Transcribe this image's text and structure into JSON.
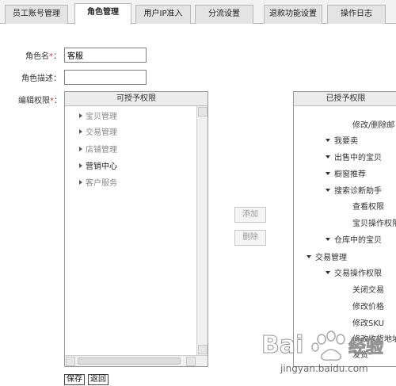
{
  "tabs": [
    {
      "label": "员工账号管理"
    },
    {
      "label": "角色管理"
    },
    {
      "label": "用户IP准入"
    },
    {
      "label": "分流设置"
    },
    {
      "label": "退款功能设置"
    },
    {
      "label": "操作日志"
    }
  ],
  "form": {
    "role_name_label": "角色名",
    "role_name_value": "客服",
    "role_desc_label": "角色描述",
    "role_desc_value": "",
    "edit_perm_label": "编辑权限",
    "required_mark": "*",
    "colon": "："
  },
  "available": {
    "title": "可授予权限",
    "items": [
      "宝贝管理",
      "交易管理",
      "店铺管理",
      "营销中心",
      "客户服务"
    ]
  },
  "granted": {
    "title": "已授予权限",
    "items": [
      "修改/删除邮",
      "我要卖",
      "出售中的宝贝",
      "橱窗推荐",
      "搜索诊断助手",
      "查看权限",
      "宝贝操作权限",
      "仓库中的宝贝",
      "交易管理",
      "交易操作权限",
      "关闭交易",
      "修改价格",
      "修改SKU",
      "修改收货地址",
      "发货"
    ]
  },
  "buttons": {
    "add": "添加",
    "remove": "删除",
    "save": "保存",
    "back": "返回"
  },
  "watermark": {
    "brand": "Bai",
    "suffix": "经验",
    "url": "jingyan.baidu.com"
  }
}
